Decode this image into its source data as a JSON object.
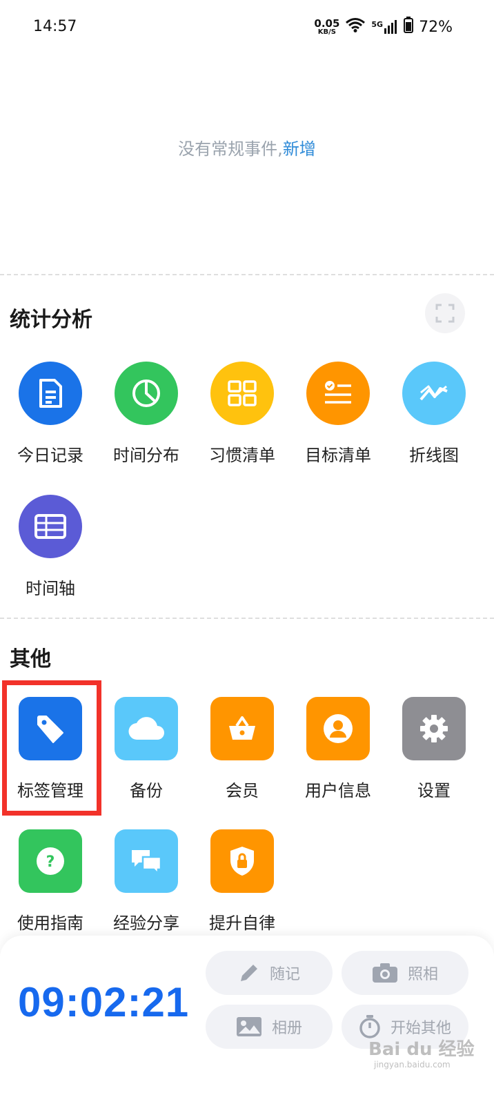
{
  "status_bar": {
    "time": "14:57",
    "net_speed_value": "0.05",
    "net_speed_unit": "KB/S",
    "network": "5G",
    "battery": "72%"
  },
  "events": {
    "empty_text": "没有常规事件,",
    "add_link": "新增"
  },
  "stats_section": {
    "title": "统计分析",
    "items": [
      {
        "label": "今日记录",
        "icon": "document-icon",
        "color": "#1a73e8"
      },
      {
        "label": "时间分布",
        "icon": "pie-chart-icon",
        "color": "#33c55d"
      },
      {
        "label": "习惯清单",
        "icon": "grid-icon",
        "color": "#ffc20e"
      },
      {
        "label": "目标清单",
        "icon": "checklist-icon",
        "color": "#ff9500"
      },
      {
        "label": "折线图",
        "icon": "line-chart-icon",
        "color": "#5ac8fa"
      },
      {
        "label": "时间轴",
        "icon": "table-icon",
        "color": "#5b5bd6"
      }
    ]
  },
  "other_section": {
    "title": "其他",
    "items": [
      {
        "label": "标签管理",
        "icon": "tag-icon",
        "color": "#1a73e8"
      },
      {
        "label": "备份",
        "icon": "cloud-icon",
        "color": "#5ac8fa"
      },
      {
        "label": "会员",
        "icon": "basket-icon",
        "color": "#ff9500"
      },
      {
        "label": "用户信息",
        "icon": "user-icon",
        "color": "#ff9500"
      },
      {
        "label": "设置",
        "icon": "gear-icon",
        "color": "#8e8e93"
      },
      {
        "label": "使用指南",
        "icon": "help-icon",
        "color": "#33c55d"
      },
      {
        "label": "经验分享",
        "icon": "chat-icon",
        "color": "#5ac8fa"
      },
      {
        "label": "提升自律",
        "icon": "shield-lock-icon",
        "color": "#ff9500"
      }
    ]
  },
  "bottom_panel": {
    "timer": "09:02:21",
    "actions": {
      "note": "随记",
      "camera": "照相",
      "album": "相册",
      "start_other": "开始其他"
    }
  },
  "watermark": {
    "text": "Bai du 经验",
    "sub": "jingyan.baidu.com"
  }
}
